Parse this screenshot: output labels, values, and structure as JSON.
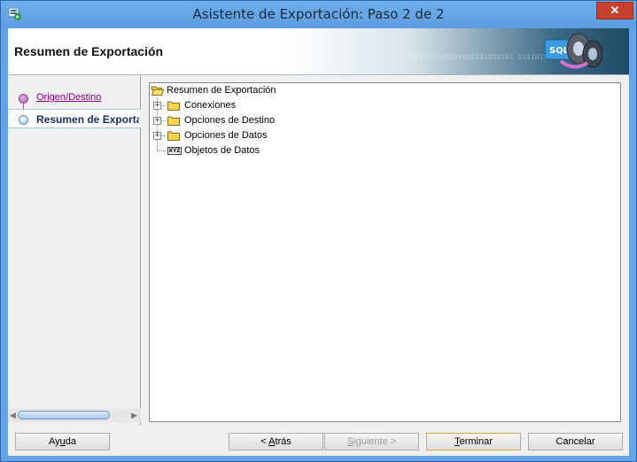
{
  "window": {
    "title": "Asistente de Exportación: Paso 2 de 2",
    "close_glyph": "✕"
  },
  "header": {
    "title": "Resumen de Exportación",
    "binary_text": "010101010101010101010101   0101010101"
  },
  "steps": [
    {
      "label": "Origen/Destino",
      "state": "visited"
    },
    {
      "label": "Resumen de Exportación",
      "state": "current"
    }
  ],
  "tree": {
    "root": {
      "label": "Resumen de Exportación",
      "icon": "open-folder-icon"
    },
    "children": [
      {
        "label": "Conexiones",
        "icon": "folder-icon",
        "expandable": true
      },
      {
        "label": "Opciones de Destino",
        "icon": "folder-icon",
        "expandable": true
      },
      {
        "label": "Opciones de Datos",
        "icon": "folder-icon",
        "expandable": true
      },
      {
        "label": "Objetos de Datos",
        "icon": "xyz-icon",
        "icon_text": "XYZ",
        "expandable": false
      }
    ]
  },
  "buttons": {
    "help": {
      "pre": "Ay",
      "mnemonic": "u",
      "post": "da"
    },
    "back": {
      "pre": "< ",
      "mnemonic": "A",
      "post": "trás"
    },
    "next": {
      "pre": "",
      "mnemonic": "S",
      "post": "iguiente >"
    },
    "finish": {
      "pre": "",
      "mnemonic": "T",
      "post": "erminar"
    },
    "cancel": {
      "label": "Cancelar"
    }
  },
  "colors": {
    "titlebar": "#63a3e6",
    "visited_step": "#800080",
    "current_step": "#1a2f66",
    "default_button_border": "#e0a44c",
    "close_button": "#c7412f"
  }
}
